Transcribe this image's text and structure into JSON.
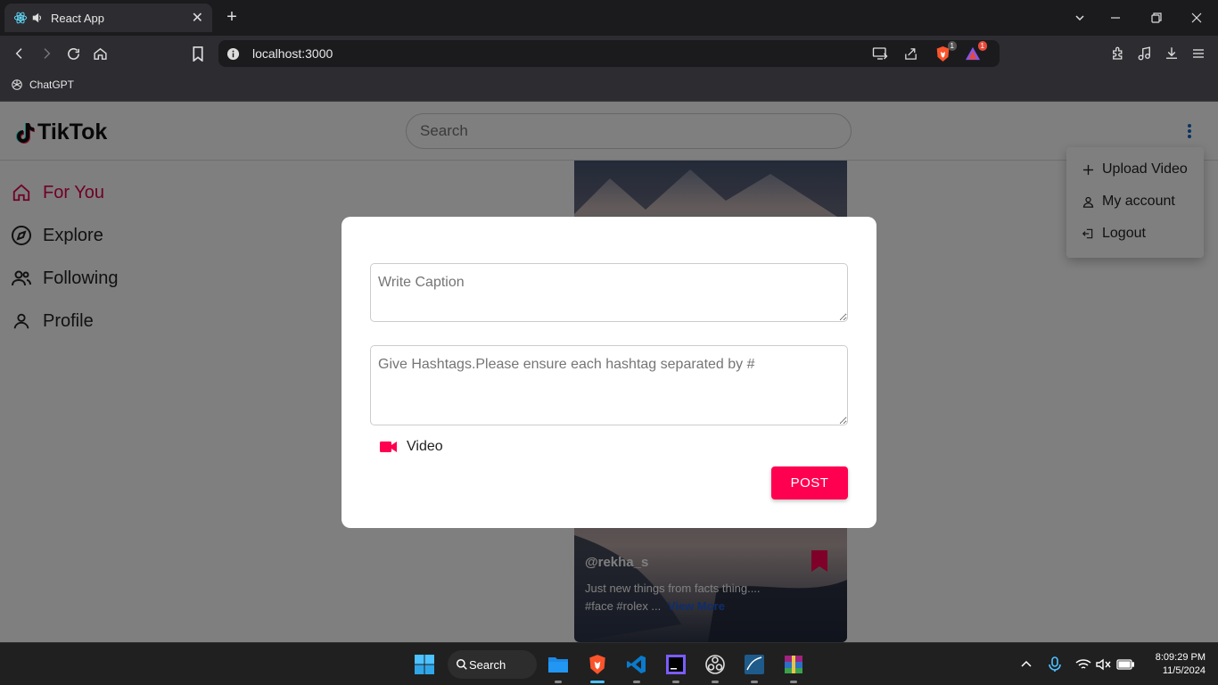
{
  "browser": {
    "tab_title": "React App",
    "url": "localhost:3000",
    "bookmark": "ChatGPT",
    "brave_badge": "1",
    "rewards_badge": "1"
  },
  "app": {
    "brand": "TikTok",
    "search_placeholder": "Search",
    "nav": [
      {
        "label": "For You",
        "icon": "home-icon",
        "active": true
      },
      {
        "label": "Explore",
        "icon": "compass-icon",
        "active": false
      },
      {
        "label": "Following",
        "icon": "people-icon",
        "active": false
      },
      {
        "label": "Profile",
        "icon": "person-icon",
        "active": false
      }
    ],
    "menu": [
      {
        "label": "Upload Video",
        "icon": "plus-icon"
      },
      {
        "label": "My account",
        "icon": "person-icon"
      },
      {
        "label": "Logout",
        "icon": "logout-icon"
      }
    ],
    "video": {
      "handle": "@rekha_s",
      "description": "Just new things from facts thing....",
      "tags": "#face #rolex ...",
      "view_more": "View More"
    },
    "accent": "#ff0050"
  },
  "modal": {
    "caption_placeholder": "Write Caption",
    "hashtag_placeholder": "Give Hashtags.Please ensure each hashtag separated by #",
    "video_label": "Video",
    "post_label": "POST"
  },
  "taskbar": {
    "search_label": "Search",
    "time": "8:09:29 PM",
    "date": "11/5/2024"
  }
}
